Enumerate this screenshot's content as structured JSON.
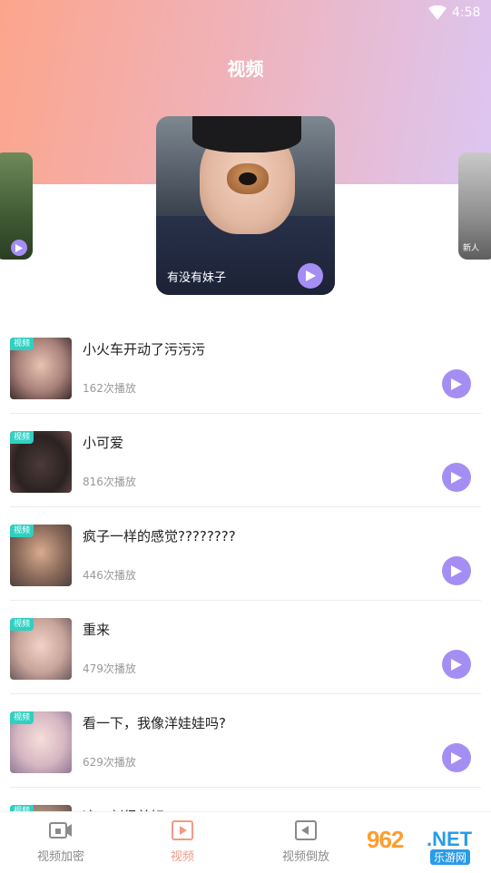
{
  "status_bar": {
    "time": "4:58",
    "wifi_icon": "wifi-icon"
  },
  "header": {
    "title": "视频"
  },
  "carousel": {
    "featured": {
      "caption": "有没有妹子",
      "play_icon": "play-icon"
    },
    "right_card_tag": "新人"
  },
  "list": {
    "tag_label": "视频",
    "items": [
      {
        "title": "小火车开动了污污污",
        "count": "162次播放"
      },
      {
        "title": "小可爱",
        "count": "816次播放"
      },
      {
        "title": "疯子一样的感觉????????",
        "count": "446次播放"
      },
      {
        "title": "重来",
        "count": "479次播放"
      },
      {
        "title": "看一下，我像洋娃娃吗?",
        "count": "629次播放"
      },
      {
        "title": "这一刻很美好????????",
        "count": ""
      }
    ]
  },
  "bottom_nav": {
    "items": [
      {
        "label": "视频加密",
        "icon": "video-lock-icon",
        "active": false
      },
      {
        "label": "视频",
        "icon": "video-play-icon",
        "active": true
      },
      {
        "label": "视频倒放",
        "icon": "video-reverse-icon",
        "active": false
      }
    ]
  },
  "watermark": {
    "number": "962",
    "suffix": ".NET",
    "subtitle": "乐游网"
  },
  "colors": {
    "accent": "#a58ef3",
    "active_nav": "#f39a86",
    "tag": "#2fd0c1"
  }
}
